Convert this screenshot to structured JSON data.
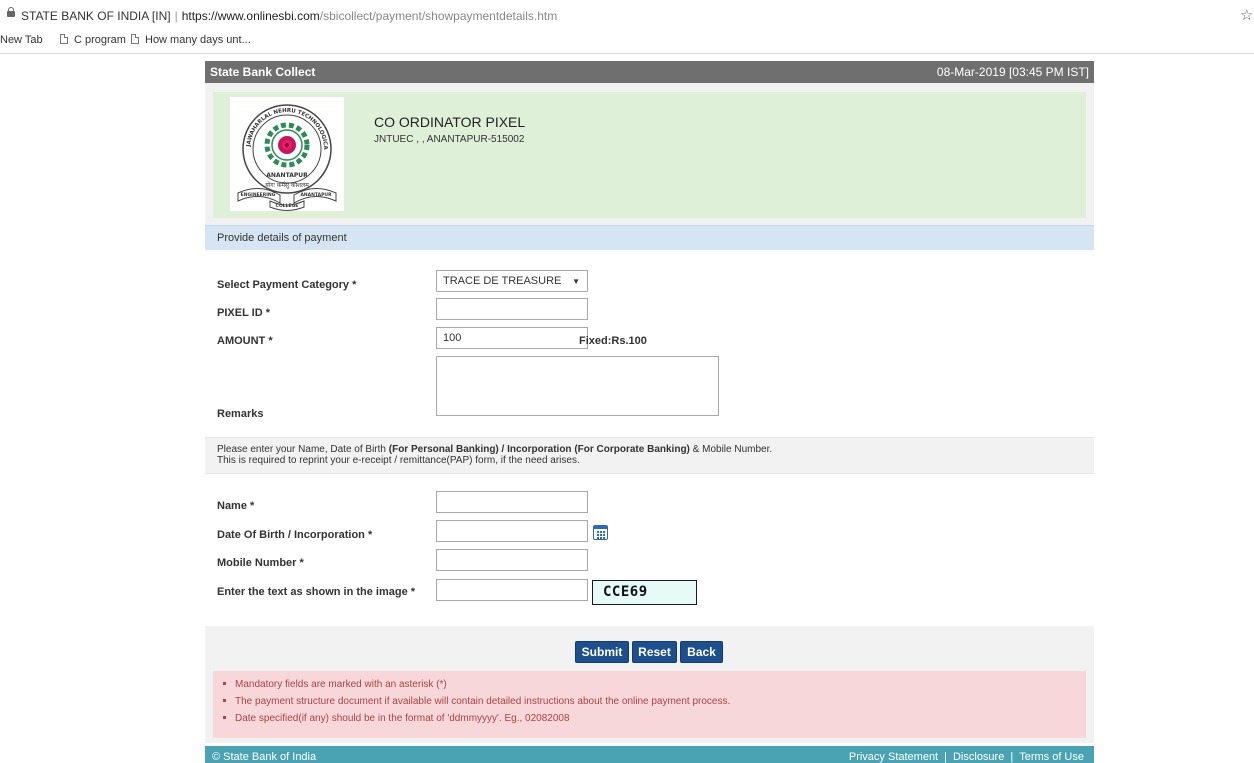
{
  "browser": {
    "site_name": "STATE BANK OF INDIA [IN]",
    "separator": "|",
    "url_host": "https://www.onlinesbi.com",
    "url_path": "/sbicollect/payment/showpaymentdetails.htm",
    "bookmarks": [
      "New Tab",
      "C program",
      "How many days unt..."
    ]
  },
  "header": {
    "title": "State Bank Collect",
    "datetime": "08-Mar-2019 [03:45 PM IST]"
  },
  "institution": {
    "name": "CO ORDINATOR PIXEL",
    "address": "JNTUEC , , ANANTAPUR-515002",
    "logo_top_text": "JAWAHARLAL NEHRU TECHNOLOGICAL UNIVERSITY",
    "logo_city": "ANANTAPUR",
    "logo_motto": "योगः कर्मसु कौशलम्",
    "logo_ribbon_left": "ENGINEERING",
    "logo_ribbon_right": "ANANTAPUR",
    "logo_ribbon_bottom": "COLLEGE"
  },
  "payment_section": {
    "heading": "Provide details of payment",
    "category_label": "Select Payment Category *",
    "category_value": "TRACE DE TREASURE",
    "pixel_id_label": "PIXEL ID *",
    "pixel_id_value": "",
    "amount_label": "AMOUNT *",
    "amount_value": "100",
    "amount_note": "Fixed:Rs.100",
    "remarks_label": "Remarks"
  },
  "notice": {
    "part1": "Please enter your Name, Date of Birth ",
    "bold1": "(For Personal Banking) / Incorporation (For Corporate Banking)",
    "part2": "  & Mobile Number.",
    "line2": "This is required to reprint your e-receipt / remittance(PAP) form, if the need arises."
  },
  "personal_section": {
    "name_label": "Name *",
    "dob_label": "Date Of Birth / Incorporation *",
    "mobile_label": "Mobile Number *",
    "captcha_label": "Enter the text as shown in the image *",
    "captcha_text": "CCE69"
  },
  "buttons": {
    "submit": "Submit",
    "reset": "Reset",
    "back": "Back"
  },
  "info_notes": [
    "Mandatory fields are marked with an asterisk (*)",
    "The payment structure document if available will contain detailed instructions about the online payment process.",
    "Date specified(if any) should be in the format of 'ddmmyyyy'. Eg., 02082008"
  ],
  "footer": {
    "copyright": "© State Bank of India",
    "privacy": "Privacy Statement",
    "disclosure": "Disclosure",
    "terms": "Terms of Use",
    "pipe": "|"
  },
  "colors": {
    "topbar": "#6f6f6f",
    "banner": "#dff0d8",
    "section_head": "#d6e5f3",
    "button": "#1c4f8c",
    "info_bg": "#f8d7da",
    "info_text": "#a94442",
    "footer": "#4aa3b3"
  }
}
